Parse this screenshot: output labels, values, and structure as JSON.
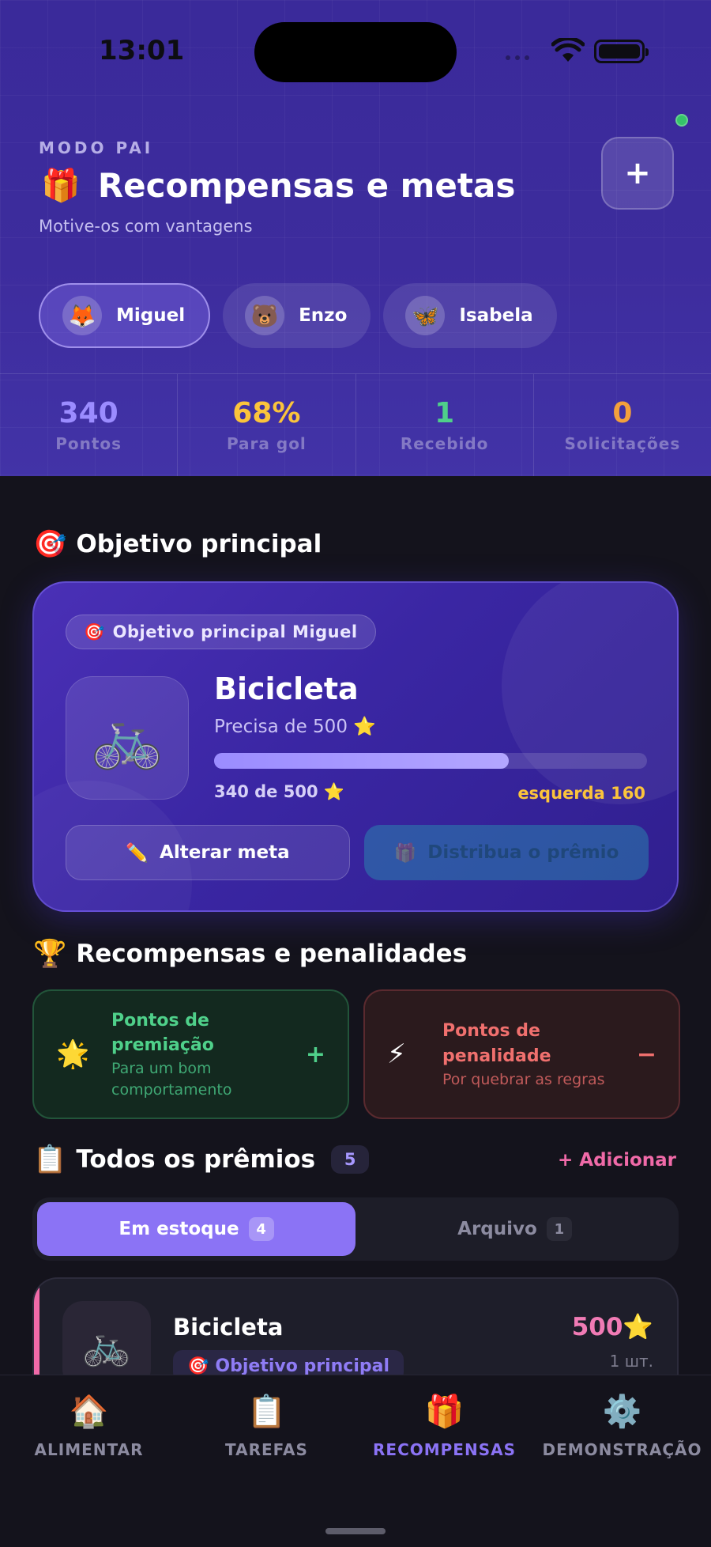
{
  "status": {
    "time": "13:01"
  },
  "header": {
    "mode_label": "MODO PAI",
    "title_icon": "🎁",
    "title": "Recompensas e metas",
    "subtitle": "Motive-os com vantagens",
    "add_label": "+"
  },
  "kids": [
    {
      "avatar": "🦊",
      "name": "Miguel",
      "active": true
    },
    {
      "avatar": "🐻",
      "name": "Enzo",
      "active": false
    },
    {
      "avatar": "🦋",
      "name": "Isabela",
      "active": false
    }
  ],
  "stats": [
    {
      "value": "340",
      "label": "Pontos",
      "color": "#9b8cff"
    },
    {
      "value": "68%",
      "label": "Para gol",
      "color": "#fbc43b"
    },
    {
      "value": "1",
      "label": "Recebido",
      "color": "#4fd08a"
    },
    {
      "value": "0",
      "label": "Solicitações",
      "color": "#f3a03c"
    }
  ],
  "goal_section": {
    "icon": "🎯",
    "title": "Objetivo principal",
    "pill_icon": "🎯",
    "pill_label": "Objetivo principal Miguel",
    "image": "🚲",
    "name": "Bicicleta",
    "need": "Precisa de 500 ⭐",
    "progress_fraction": 0.68,
    "progress_text": "340 de 500 ⭐",
    "left_text": "esquerda 160",
    "edit_icon": "✏️",
    "edit_label": "Alterar meta",
    "give_icon": "🎁",
    "give_label": "Distribua o prêmio"
  },
  "rewards_section": {
    "icon": "🏆",
    "title": "Recompensas e penalidades",
    "reward": {
      "icon": "🌟",
      "title": "Pontos de premiação",
      "subtitle": "Para um bom comportamento",
      "sign": "+"
    },
    "penalty": {
      "icon": "⚡",
      "title": "Pontos de penalidade",
      "subtitle": "Por quebrar as regras",
      "sign": "−"
    }
  },
  "prizes_section": {
    "icon": "📋",
    "title": "Todos os prêmios",
    "count": "5",
    "add_label": "+ Adicionar",
    "tabs": [
      {
        "label": "Em estoque",
        "count": "4",
        "active": true
      },
      {
        "label": "Arquivo",
        "count": "1",
        "active": false
      }
    ],
    "items": [
      {
        "image": "🚲",
        "name": "Bicicleta",
        "tag_icon": "🎯",
        "tag": "Objetivo principal",
        "points": "500⭐",
        "qty": "1 шт."
      }
    ]
  },
  "nav": [
    {
      "icon": "🏠",
      "label": "ALIMENTAR",
      "active": false
    },
    {
      "icon": "📋",
      "label": "TAREFAS",
      "active": false
    },
    {
      "icon": "🎁",
      "label": "RECOMPENSAS",
      "active": true
    },
    {
      "icon": "⚙️",
      "label": "DEMONSTRAÇÃO",
      "active": false
    }
  ]
}
